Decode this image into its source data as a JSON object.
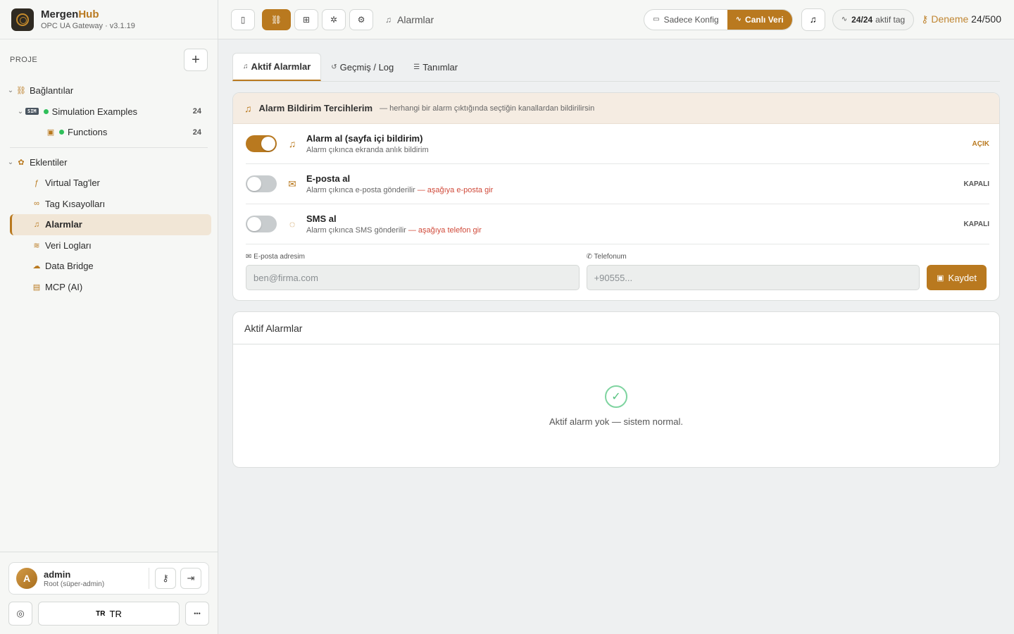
{
  "brand": {
    "name_main": "Mergen",
    "name_accent": "Hub",
    "subtitle": "OPC UA Gateway · v3.1.19"
  },
  "sidebar": {
    "section_label": "PROJE",
    "add_label": "+",
    "tree": {
      "connections": "Bağlantılar",
      "sim_badge": "SIM",
      "sim_name": "Simulation Examples",
      "sim_count": "24",
      "functions": "Functions",
      "functions_count": "24",
      "plugins": "Eklentiler",
      "items": [
        "Virtual Tag'ler",
        "Tag Kısayolları",
        "Alarmlar",
        "Veri Logları",
        "Data Bridge",
        "MCP (AI)"
      ]
    },
    "user": {
      "initial": "A",
      "name": "admin",
      "role": "Root (süper-admin)"
    },
    "lang": {
      "flag": "TR",
      "label": "TR"
    },
    "more": "•••"
  },
  "topbar": {
    "breadcrumb": "Alarmlar",
    "mode_config": "Sadece Konfig",
    "mode_live": "Canlı Veri",
    "tags_count": "24/24",
    "tags_label": "aktif tag",
    "trial_label": "Deneme",
    "trial_value": "24/500"
  },
  "tabs": [
    "Aktif Alarmlar",
    "Geçmiş / Log",
    "Tanımlar"
  ],
  "prefs": {
    "title": "Alarm Bildirim Tercihlerim",
    "subtitle": "— herhangi bir alarm çıktığında seçtiğin kanallardan bildirilirsin",
    "rows": [
      {
        "title": "Alarm al (sayfa içi bildirim)",
        "desc": "Alarm çıkınca ekranda anlık bildirim",
        "hint": "",
        "state": "AÇIK"
      },
      {
        "title": "E-posta al",
        "desc": "Alarm çıkınca e-posta gönderilir",
        "hint": "— aşağıya e-posta gir",
        "state": "KAPALI"
      },
      {
        "title": "SMS al",
        "desc": "Alarm çıkınca SMS gönderilir",
        "hint": "— aşağıya telefon gir",
        "state": "KAPALI"
      }
    ],
    "email_label": "E-posta adresim",
    "email_placeholder": "ben@firma.com",
    "phone_label": "Telefonum",
    "phone_placeholder": "+90555...",
    "save_label": "Kaydet"
  },
  "active": {
    "title": "Aktif Alarmlar",
    "empty": "Aktif alarm yok — sistem normal."
  },
  "colors": {
    "accent": "#b9791f",
    "ok": "#56c27f",
    "hint": "#d04a3a"
  }
}
